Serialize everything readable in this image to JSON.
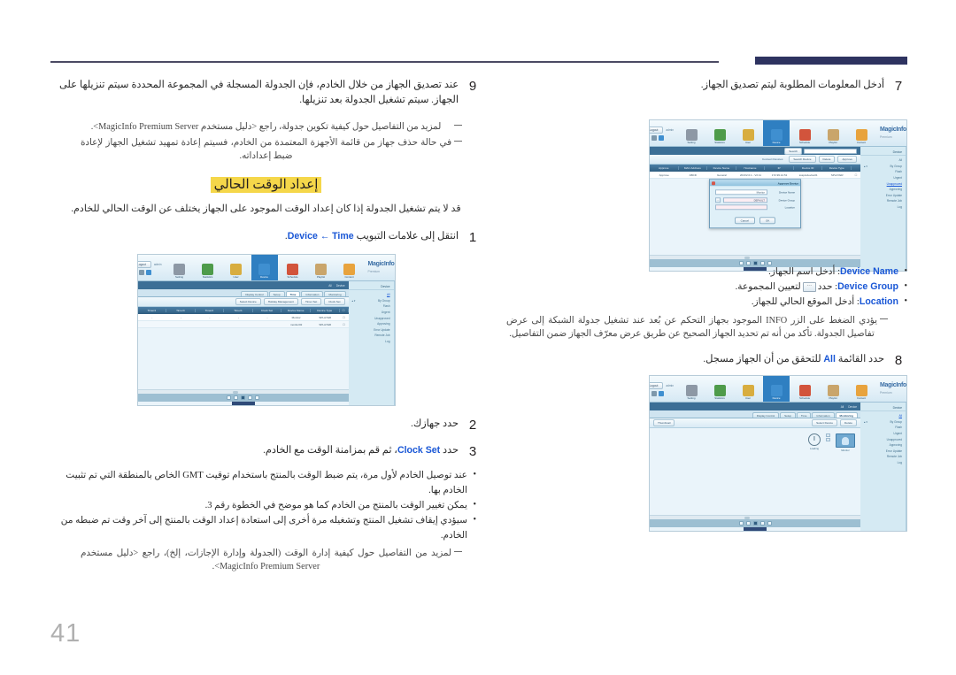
{
  "page": {
    "number": "41",
    "language": "ar"
  },
  "left_column": {
    "step9": {
      "num": "9",
      "text": "عند تصديق الجهاز من خلال الخادم، فإن الجدولة المسجلة في المجموعة المحددة سيتم تنزيلها على الجهاز. سيتم تشغيل الجدولة بعد تنزيلها.",
      "notes": [
        "لمزيد من التفاصيل حول كيفية تكوين جدولة، راجع <دليل مستخدم MagicInfo Premium Server>.",
        "في حالة حذف جهاز من قائمة الأجهزة المعتمدة من الخادم، فسيتم إعادة تمهيد تشغيل الجهاز لإعادة ضبط إعداداته."
      ]
    },
    "section": {
      "heading": "إعداد الوقت الحالي",
      "lead": "قد لا يتم تشغيل الجدولة إذا كان إعداد الوقت الموجود على الجهاز يختلف عن الوقت الحالي للخادم."
    },
    "step1": {
      "num": "1",
      "text_before": "انتقل إلى علامات التبويب",
      "ui_a": "Device",
      "arrow": "←",
      "ui_b": "Time",
      "text_after": "."
    },
    "step2": {
      "num": "2",
      "text": "حدد جهازك."
    },
    "step3": {
      "num": "3",
      "text_before": "حدد",
      "ui": "Clock Set",
      "text_after": "، ثم قم بمزامنة الوقت مع الخادم."
    },
    "bullets": [
      "عند توصيل الخادم لأول مرة، يتم ضبط الوقت بالمنتج باستخدام توقيت GMT الخاص بالمنطقة التي تم تثبيت الخادم بها.",
      "يمكن تغيير الوقت بالمنتج من الخادم كما هو موضح في الخطوة رقم 3.",
      "سيؤدي إيقاف تشغيل المنتج وتشغيله مرة أخرى إلى استعادة إعداد الوقت بالمنتج إلى آخر وقت تم ضبطه من الخادم."
    ],
    "bullet_note": "لمزيد من التفاصيل حول كيفية إدارة الوقت (الجدولة وإدارة الإجازات، إلخ)، راجع <دليل مستخدم MagicInfo Premium Server>."
  },
  "right_column": {
    "step7": {
      "num": "7",
      "text": "أدخل المعلومات المطلوبة ليتم تصديق الجهاز."
    },
    "fields": [
      {
        "name": "Device Name",
        "desc": "أدخل اسم الجهاز."
      },
      {
        "name": "Device Group",
        "desc_before": "حدد",
        "desc_after": "لتعيين المجموعة.",
        "has_button": true,
        "button_glyph": "•••"
      },
      {
        "name": "Location",
        "desc": "أدخل الموقع الحالي للجهاز."
      }
    ],
    "info_note": "يؤدي الضغط على الزر INFO الموجود بجهاز التحكم عن بُعد عند تشغيل جدولة الشبكة إلى عرض تفاصيل الجدولة. تأكد من أنه تم تحديد الجهاز الصحيح عن طريق عرض معرّف الجهاز ضمن التفاصيل.",
    "step8": {
      "num": "8",
      "text_before": "حدد القائمة",
      "ui": "All",
      "text_after": "للتحقق من أن الجهاز مسجل."
    }
  },
  "app_screenshot": {
    "brand": "MagicInfo",
    "brand_sub": "Premium",
    "nav_items": [
      {
        "label": "Content",
        "icon": "content-icon",
        "color": "#e8a33d"
      },
      {
        "label": "Playlist",
        "icon": "playlist-icon",
        "color": "#c9a56b"
      },
      {
        "label": "Schedule",
        "icon": "schedule-icon",
        "color": "#d2543c"
      },
      {
        "label": "Device",
        "icon": "device-icon",
        "color": "#3f8fd0",
        "active": true
      },
      {
        "label": "User",
        "icon": "user-icon",
        "color": "#d8ad3f"
      },
      {
        "label": "Statistics",
        "icon": "statistics-icon",
        "color": "#4e9b4a"
      },
      {
        "label": "Setting",
        "icon": "setting-icon",
        "color": "#8d98a5"
      }
    ],
    "user": "admin",
    "logout": "Logout",
    "sidebar": {
      "title": "Device",
      "rows": [
        "All",
        "By Group",
        "Flash",
        "Urgent",
        "Unapproved",
        "Approving",
        "Error Update",
        "Remote Job",
        "Log"
      ]
    },
    "device_list": {
      "breadcrumb": [
        "Device",
        "Unapproved"
      ],
      "toolbar": [
        "Approve",
        "Delete",
        "Search Device"
      ],
      "toolbar_right": "Connect Devices",
      "headers": [
        "",
        "Device Type",
        "Device ID",
        "IP",
        "Hostname",
        "Device Name",
        "MAC Address",
        "Approve"
      ],
      "rows": [
        {
          "type": "SPLAYER",
          "id": "ssspd-device01",
          "ip": "172.99.12.51",
          "hostname": "201V2.0.1 - V2.11",
          "device_name": "General",
          "mac": "ABCD",
          "action": "Approve"
        }
      ],
      "search_button": "Search"
    },
    "approve_dialog": {
      "title": "Approve Device",
      "fields": [
        {
          "label": "Device Name",
          "value": "Monitor"
        },
        {
          "label": "Device Group",
          "value": "DEFAULT",
          "has_browse": true
        },
        {
          "label": "Location",
          "value": ""
        }
      ],
      "ok": "OK",
      "cancel": "Cancel"
    },
    "all_view": {
      "breadcrumb": [
        "Device",
        "All"
      ],
      "tabs": [
        "Monitoring",
        "Information",
        "Time",
        "Setup",
        "Display Control"
      ],
      "active_tab": "Monitoring",
      "toolbar": [
        "Delete"
      ],
      "right_controls": [
        "Select Device",
        "Thumbnail"
      ],
      "device_card": {
        "name": "Monitor",
        "power": "Loading"
      }
    },
    "time_view": {
      "breadcrumb": [
        "Device",
        "All"
      ],
      "tabs": [
        "Monitoring",
        "Information",
        "Time",
        "Setup",
        "Display Control"
      ],
      "active_tab": "Time",
      "toolbar": [
        "Clock Set",
        "Timer Set",
        "Holiday Management"
      ],
      "toolbar_right": "Select Device",
      "headers": [
        "",
        "Device Type",
        "Device Name",
        "Clock Set",
        "Timer1",
        "Timer2",
        "Timer3",
        "Timer4"
      ],
      "rows": [
        {
          "type": "SPLAYER",
          "name": "Monitor"
        },
        {
          "type": "SPLAYER",
          "name": "monitor02"
        }
      ]
    },
    "pager": {
      "pages": [
        "1",
        "2",
        "3",
        "4",
        "5"
      ],
      "current": "3"
    }
  }
}
